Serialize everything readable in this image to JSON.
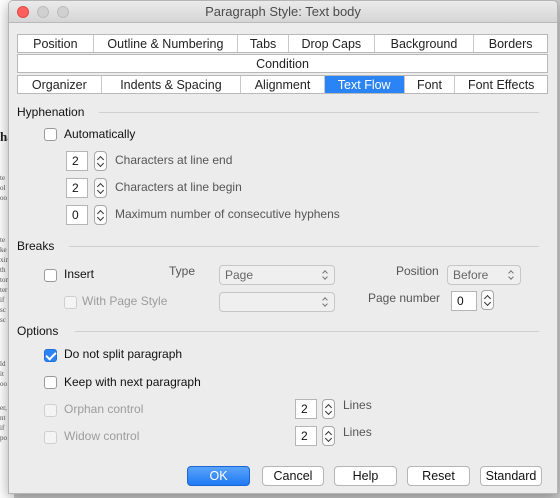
{
  "window": {
    "title": "Paragraph Style: Text body"
  },
  "tabs_row1": [
    "Position",
    "Outline & Numbering",
    "Tabs",
    "Drop Caps",
    "Background",
    "Borders"
  ],
  "tabs_row2": [
    "Condition"
  ],
  "tabs_row3": [
    "Organizer",
    "Indents & Spacing",
    "Alignment",
    "Text Flow",
    "Font",
    "Font Effects"
  ],
  "selected_tab": "Text Flow",
  "hyphenation": {
    "heading": "Hyphenation",
    "automatically": {
      "label": "Automatically",
      "checked": false
    },
    "line_end": {
      "value": "2",
      "label": "Characters at line end"
    },
    "line_begin": {
      "value": "2",
      "label": "Characters at line begin"
    },
    "max_hyphens": {
      "value": "0",
      "label": "Maximum number of consecutive hyphens"
    }
  },
  "breaks": {
    "heading": "Breaks",
    "insert": {
      "label": "Insert",
      "checked": false
    },
    "type_label": "Type",
    "type_value": "Page",
    "position_label": "Position",
    "position_value": "Before",
    "page_style": {
      "label": "With Page Style",
      "checked": false
    },
    "page_style_value": "",
    "page_number_label": "Page number",
    "page_number_value": "0"
  },
  "options": {
    "heading": "Options",
    "do_not_split": {
      "label": "Do not split paragraph",
      "checked": true
    },
    "keep_with_next": {
      "label": "Keep with next paragraph",
      "checked": false
    },
    "orphan": {
      "label": "Orphan control",
      "value": "2",
      "unit": "Lines",
      "checked": false
    },
    "widow": {
      "label": "Widow control",
      "value": "2",
      "unit": "Lines",
      "checked": false
    }
  },
  "buttons": {
    "ok": "OK",
    "cancel": "Cancel",
    "help": "Help",
    "reset": "Reset",
    "standard": "Standard"
  },
  "background_doc": {
    "heading_fragment": "ha",
    "lines": [
      "te",
      "ol",
      "oo",
      "",
      "",
      "",
      "",
      "te",
      "ke",
      "xin",
      "th",
      "ton",
      "ter",
      "if",
      "sc",
      "sc",
      "",
      "",
      "ld",
      "it",
      "oo",
      "",
      "",
      "er,",
      "nt",
      "if",
      "po"
    ]
  }
}
